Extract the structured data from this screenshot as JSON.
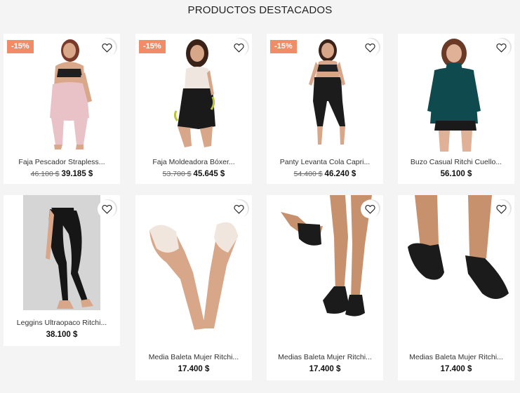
{
  "section": {
    "title": "PRODUCTOS DESTACADOS"
  },
  "products": [
    {
      "name": "Faja Pescador Strapless...",
      "old_price": "46.100 $",
      "price": "39.185 $",
      "badge": "-15%"
    },
    {
      "name": "Faja Moldeadora Bóxer...",
      "old_price": "53.700 $",
      "price": "45.645 $",
      "badge": "-15%"
    },
    {
      "name": "Panty Levanta Cola Capri...",
      "old_price": "54.400 $",
      "price": "46.240 $",
      "badge": "-15%"
    },
    {
      "name": "Buzo Casual Ritchi Cuello...",
      "old_price": "",
      "price": "56.100 $",
      "badge": ""
    },
    {
      "name": "Leggins Ultraopaco Ritchi...",
      "old_price": "",
      "price": "38.100 $",
      "badge": ""
    },
    {
      "name": "Media Baleta Mujer Ritchi...",
      "old_price": "",
      "price": "17.400 $",
      "badge": ""
    },
    {
      "name": "Medias Baleta Mujer Ritchi...",
      "old_price": "",
      "price": "17.400 $",
      "badge": ""
    },
    {
      "name": "Medias Baleta Mujer Ritchi...",
      "old_price": "",
      "price": "17.400 $",
      "badge": ""
    }
  ],
  "colors": {
    "badge": "#f08d68",
    "background": "#f4f4f4",
    "card": "#ffffff"
  },
  "icons": {
    "wishlist": "heart-icon"
  }
}
